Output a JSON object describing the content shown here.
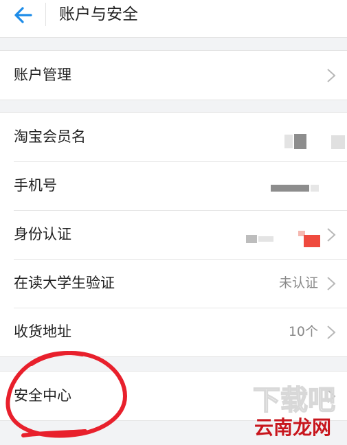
{
  "header": {
    "title": "账户与安全",
    "back_icon": "back-arrow-icon"
  },
  "groups": [
    {
      "rows": [
        {
          "label": "账户管理",
          "value": "",
          "chevron": true
        }
      ]
    },
    {
      "rows": [
        {
          "label": "淘宝会员名",
          "value": "",
          "chevron": false
        },
        {
          "label": "手机号",
          "value": "",
          "chevron": false
        },
        {
          "label": "身份认证",
          "value": "",
          "chevron": true
        },
        {
          "label": "在读大学生验证",
          "value": "未认证",
          "chevron": true
        },
        {
          "label": "收货地址",
          "value": "10个",
          "chevron": true
        }
      ]
    },
    {
      "rows": [
        {
          "label": "安全中心",
          "value": "",
          "chevron": true
        }
      ]
    }
  ],
  "watermark": {
    "text": "云南龙网"
  },
  "colors": {
    "accent": "#1e8ce8",
    "annotation": "#e8202c",
    "watermark": "#c8161d"
  }
}
